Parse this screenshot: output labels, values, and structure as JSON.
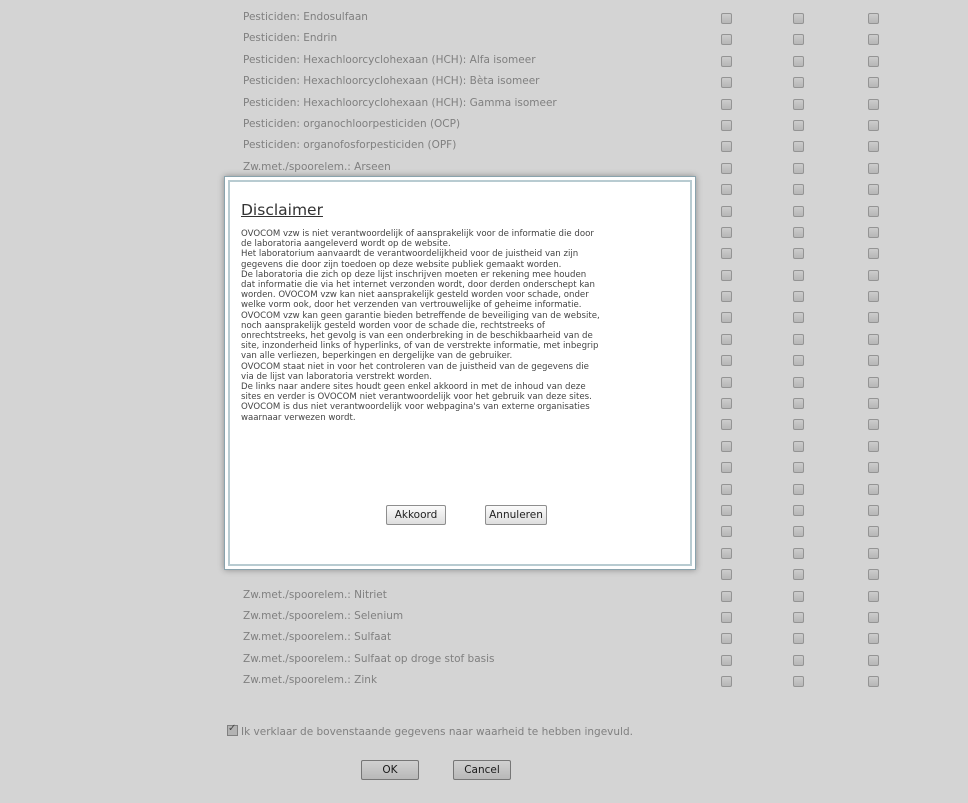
{
  "rows": [
    {
      "label": "Pesticiden: Endosulfaan"
    },
    {
      "label": "Pesticiden: Endrin"
    },
    {
      "label": "Pesticiden: Hexachloorcyclohexaan (HCH): Alfa isomeer"
    },
    {
      "label": "Pesticiden: Hexachloorcyclohexaan (HCH): Bèta isomeer"
    },
    {
      "label": "Pesticiden: Hexachloorcyclohexaan (HCH): Gamma isomeer"
    },
    {
      "label": "Pesticiden: organochloorpesticiden (OCP)"
    },
    {
      "label": "Pesticiden: organofosforpesticiden (OPF)"
    },
    {
      "label": "Zw.met./spoorelem.: Arseen"
    },
    {
      "label": ""
    },
    {
      "label": ""
    },
    {
      "label": ""
    },
    {
      "label": ""
    },
    {
      "label": ""
    },
    {
      "label": ""
    },
    {
      "label": ""
    },
    {
      "label": ""
    },
    {
      "label": ""
    },
    {
      "label": ""
    },
    {
      "label": ""
    },
    {
      "label": ""
    },
    {
      "label": ""
    },
    {
      "label": ""
    },
    {
      "label": ""
    },
    {
      "label": ""
    },
    {
      "label": ""
    },
    {
      "label": ""
    },
    {
      "label": ""
    },
    {
      "label": "Zw.met./spoorelem.: Nitriet"
    },
    {
      "label": "Zw.met./spoorelem.: Selenium"
    },
    {
      "label": "Zw.met./spoorelem.: Sulfaat"
    },
    {
      "label": "Zw.met./spoorelem.: Sulfaat op droge stof basis"
    },
    {
      "label": "Zw.met./spoorelem.: Zink"
    }
  ],
  "declaration": {
    "checked": true,
    "text": "Ik verklaar de bovenstaande gegevens naar waarheid te hebben ingevuld."
  },
  "buttons": {
    "ok": "OK",
    "cancel": "Cancel"
  },
  "modal": {
    "title": "Disclaimer",
    "body_lines": [
      "OVOCOM vzw is niet verantwoordelijk of aansprakelijk voor de informatie die door",
      "de laboratoria aangeleverd wordt op de website.",
      "Het laboratorium aanvaardt de verantwoordelijkheid voor de juistheid van zijn",
      "gegevens die door zijn toedoen op deze website publiek gemaakt worden.",
      "De laboratoria die zich op deze lijst inschrijven moeten er rekening mee houden",
      "dat informatie die via het internet verzonden wordt, door derden onderschept kan",
      "worden. OVOCOM vzw kan niet aansprakelijk gesteld worden voor schade, onder",
      "welke vorm ook, door het verzenden van vertrouwelijke of geheime informatie.",
      "OVOCOM vzw kan geen garantie bieden betreffende de beveiliging van de website,",
      "noch aansprakelijk gesteld worden voor de schade die, rechtstreeks of",
      "onrechtstreeks, het gevolg is van een onderbreking in de beschikbaarheid van de",
      "site, inzonderheid links of hyperlinks, of van de verstrekte informatie, met inbegrip",
      "van alle verliezen, beperkingen en dergelijke van de gebruiker.",
      "OVOCOM staat niet in voor het controleren van de juistheid van de gegevens die",
      "via de lijst van laboratoria verstrekt worden.",
      "De links naar andere sites houdt geen enkel akkoord in met de inhoud van deze",
      "sites en verder is OVOCOM niet verantwoordelijk voor het gebruik van deze sites.",
      "OVOCOM is dus niet verantwoordelijk voor webpagina's van externe organisaties",
      "waarnaar verwezen wordt."
    ],
    "agree_label": "Akkoord",
    "decline_label": "Annuleren"
  }
}
